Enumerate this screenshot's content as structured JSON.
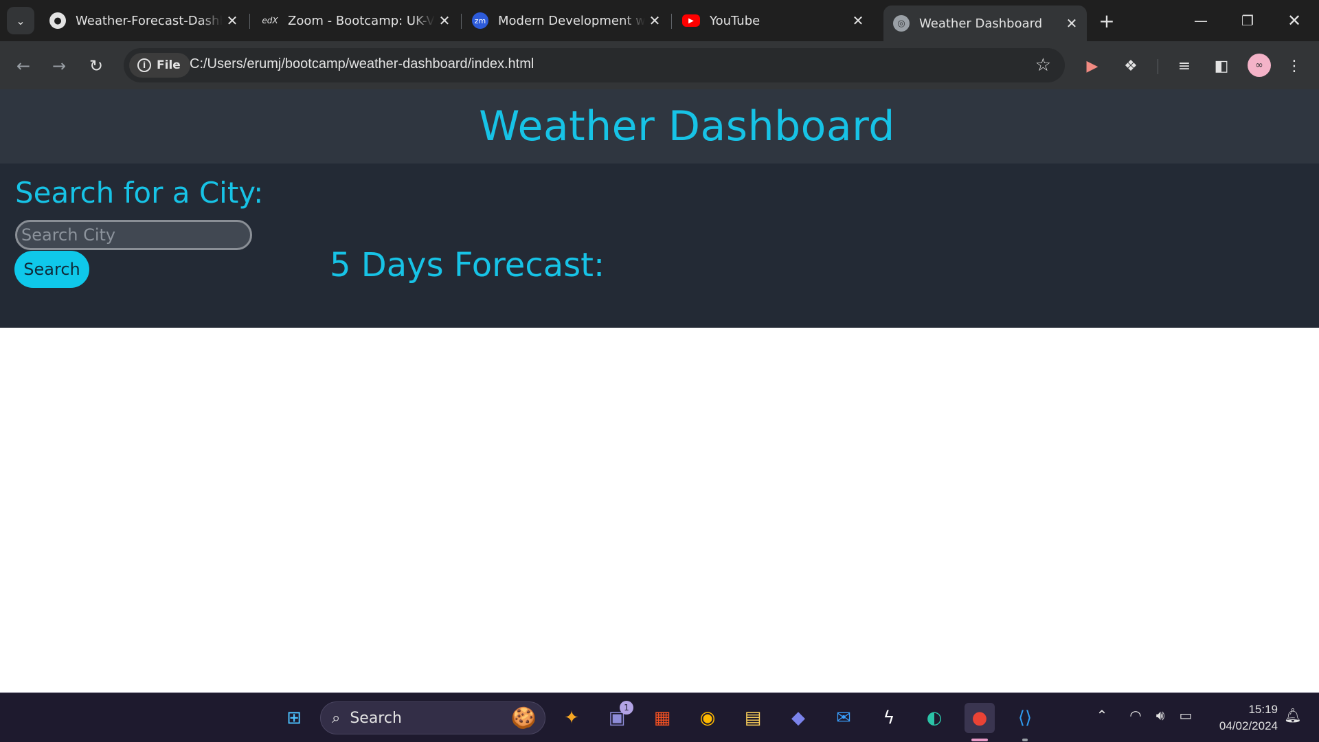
{
  "browser": {
    "tabs": [
      {
        "title": "Weather-Forecast-Dashb",
        "favicon": "github-icon",
        "active": false
      },
      {
        "title": "Zoom - Bootcamp: UK-VI",
        "favicon": "edx-icon",
        "favicon_text": "edX",
        "active": false
      },
      {
        "title": "Modern Development wi",
        "favicon": "zoom-icon",
        "favicon_text": "zm",
        "active": false
      },
      {
        "title": "YouTube",
        "favicon": "youtube-icon",
        "active": false
      },
      {
        "title": "Weather Dashboard",
        "favicon": "globe-icon",
        "active": true
      }
    ],
    "site_chip_label": "File",
    "url": "C:/Users/erumj/bootcamp/weather-dashboard/index.html"
  },
  "page": {
    "title": "Weather Dashboard",
    "search_heading": "Search for a City:",
    "search_placeholder": "Search City",
    "search_value": "",
    "search_button_label": "Search",
    "forecast_heading": "5 Days Forecast:"
  },
  "taskbar": {
    "search_label": "Search",
    "chat_badge_count": "1",
    "time": "15:19",
    "date": "04/02/2024"
  },
  "colors": {
    "accent": "#17c3e6",
    "header_bg": "#2f3640",
    "panel_bg": "#232a35",
    "button_bg": "#0fc8ea"
  }
}
